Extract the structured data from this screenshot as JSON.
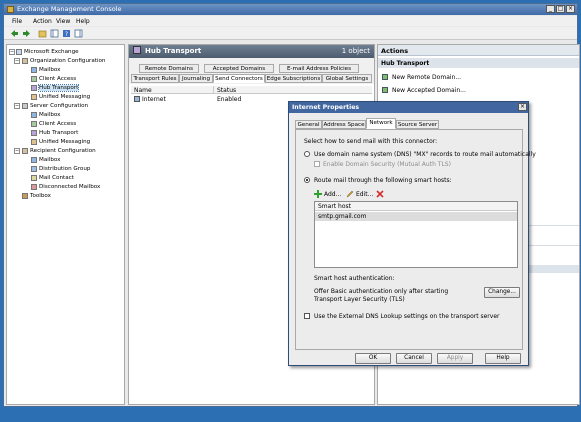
{
  "window": {
    "title": "Exchange Management Console"
  },
  "menu": [
    "File",
    "Action",
    "View",
    "Help"
  ],
  "tree": {
    "root": "Microsoft Exchange",
    "org_config": "Organization Configuration",
    "org_items": [
      "Mailbox",
      "Client Access",
      "Hub Transport",
      "Unified Messaging"
    ],
    "server_config": "Server Configuration",
    "server_items": [
      "Mailbox",
      "Client Access",
      "Hub Transport",
      "Unified Messaging"
    ],
    "recipient_config": "Recipient Configuration",
    "recipient_items": [
      "Mailbox",
      "Distribution Group",
      "Mail Contact",
      "Disconnected Mailbox"
    ],
    "toolbox": "Toolbox"
  },
  "center": {
    "title": "Hub Transport",
    "count": "1 object",
    "tabs_row1": [
      "Remote Domains",
      "Accepted Domains",
      "E-mail Address Policies"
    ],
    "tabs_row2": [
      "Transport Rules",
      "Journaling",
      "Send Connectors",
      "Edge Subscriptions",
      "Global Settings"
    ],
    "columns": [
      "Name",
      "Status"
    ],
    "rows": [
      {
        "name": "Internet",
        "status": "Enabled"
      }
    ]
  },
  "actions": {
    "header": "Actions",
    "section": "Hub Transport",
    "items": [
      "New Remote Domain...",
      "New Accepted Domain..."
    ]
  },
  "dialog": {
    "title": "Internet Properties",
    "tabs": [
      "General",
      "Address Space",
      "Network",
      "Source Server"
    ],
    "prompt": "Select how to send mail with this connector:",
    "radio_dns": "Use domain name system (DNS) \"MX\" records to route mail automatically",
    "check_domain_security": "Enable Domain Security (Mutual Auth TLS)",
    "radio_smarthost": "Route mail through the following smart hosts:",
    "add_label": "Add...",
    "edit_label": "Edit...",
    "smarthost_header": "Smart host",
    "smarthosts": [
      "smtp.gmail.com"
    ],
    "auth_label": "Smart host authentication:",
    "auth_text": "Offer Basic authentication only after starting Transport Layer Security (TLS)",
    "change_label": "Change...",
    "external_dns": "Use the External DNS Lookup settings on the transport server",
    "buttons": {
      "ok": "OK",
      "cancel": "Cancel",
      "apply": "Apply",
      "help": "Help"
    }
  }
}
